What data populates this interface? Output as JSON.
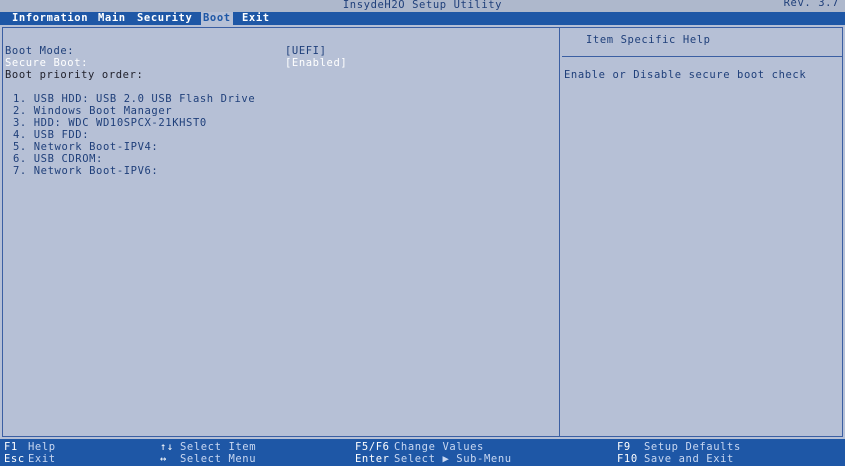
{
  "title_bar": {
    "title": "InsydeH2O Setup Utility",
    "version": "Rev. 3.7"
  },
  "menu": {
    "items": [
      {
        "label": "Information"
      },
      {
        "label": "Main"
      },
      {
        "label": "Security"
      },
      {
        "label": "Boot"
      },
      {
        "label": "Exit"
      }
    ],
    "active": "Boot"
  },
  "boot": {
    "boot_mode": {
      "label": "Boot Mode:",
      "value": "[UEFI]"
    },
    "secure_boot": {
      "label": "Secure Boot:",
      "value": "[Enabled]"
    },
    "priority_label": "Boot priority order:",
    "priority_items": [
      "1. USB HDD: USB 2.0 USB Flash Drive",
      "2. Windows Boot Manager",
      "3. HDD: WDC WD10SPCX-21KHST0",
      "4. USB FDD:",
      "5. Network Boot-IPV4:",
      "6. USB CDROM:",
      "7. Network Boot-IPV6:"
    ]
  },
  "help": {
    "title": "Item Specific Help",
    "text": "Enable or Disable secure boot check"
  },
  "footer": {
    "f1_key": "F1",
    "f1_desc": "Help",
    "esc_key": "Esc",
    "esc_desc": "Exit",
    "updown_key": "↑↓",
    "updown_desc": "Select Item",
    "leftright_key": "↔",
    "leftright_desc": "Select Menu",
    "f5f6_key": "F5/F6",
    "f5f6_desc": "Change Values",
    "enter_key": "Enter",
    "enter_desc": "Select ▶ Sub-Menu",
    "f9_key": "F9",
    "f9_desc": "Setup Defaults",
    "f10_key": "F10",
    "f10_desc": "Save and Exit"
  },
  "colors": {
    "background": "#b6c0d6",
    "menu_bar": "#1e57a6",
    "text": "#1f3f7a",
    "selected_text": "#ffffff"
  }
}
